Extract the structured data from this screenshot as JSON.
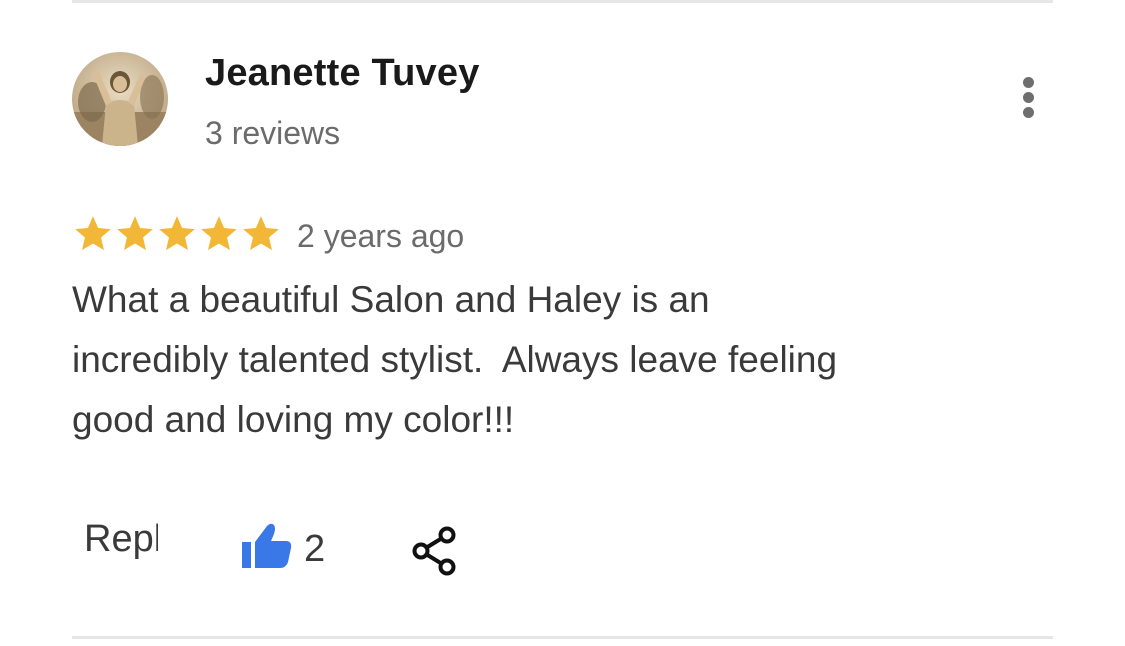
{
  "reviewer": {
    "name": "Jeanette Tuvey",
    "review_count_label": "3 reviews"
  },
  "rating": {
    "stars": 5,
    "max": 5,
    "color": "#f2b736"
  },
  "review": {
    "date_label": "2 years ago",
    "text_lines": [
      "What a beautiful Salon and Haley is an",
      "incredibly talented stylist.  Always leave feeling",
      "good and loving my color!!!"
    ]
  },
  "actions": {
    "reply_label": "Reply",
    "like_count": "2",
    "like_color": "#3b78e7",
    "more_icon": "more-vert-icon",
    "share_icon": "share-icon"
  }
}
